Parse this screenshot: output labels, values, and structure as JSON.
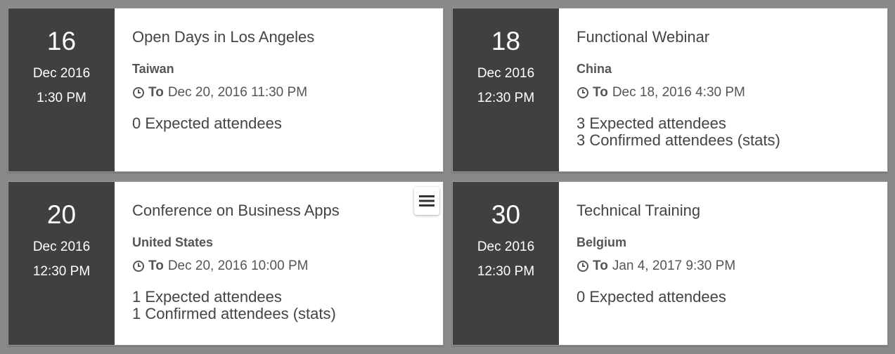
{
  "events": [
    {
      "day": "16",
      "month_year": "Dec 2016",
      "time": "1:30 PM",
      "title": "Open Days in Los Angeles",
      "country": "Taiwan",
      "to_label": "To",
      "end": "Dec 20, 2016 11:30 PM",
      "expected": "0 Expected attendees",
      "confirmed": ""
    },
    {
      "day": "18",
      "month_year": "Dec 2016",
      "time": "12:30 PM",
      "title": "Functional Webinar",
      "country": "China",
      "to_label": "To",
      "end": "Dec 18, 2016 4:30 PM",
      "expected": "3 Expected attendees",
      "confirmed": "3 Confirmed attendees (stats)"
    },
    {
      "day": "20",
      "month_year": "Dec 2016",
      "time": "12:30 PM",
      "title": "Conference on Business Apps",
      "country": "United States",
      "to_label": "To",
      "end": "Dec 20, 2016 10:00 PM",
      "expected": "1 Expected attendees",
      "confirmed": "1 Confirmed attendees (stats)"
    },
    {
      "day": "30",
      "month_year": "Dec 2016",
      "time": "12:30 PM",
      "title": "Technical Training",
      "country": "Belgium",
      "to_label": "To",
      "end": "Jan 4, 2017 9:30 PM",
      "expected": "0 Expected attendees",
      "confirmed": ""
    }
  ],
  "colors": {
    "date_box_bg": "#404040",
    "page_bg": "#8a8a8a"
  },
  "icons": {
    "clock": "clock-icon",
    "menu": "hamburger-menu-icon"
  }
}
